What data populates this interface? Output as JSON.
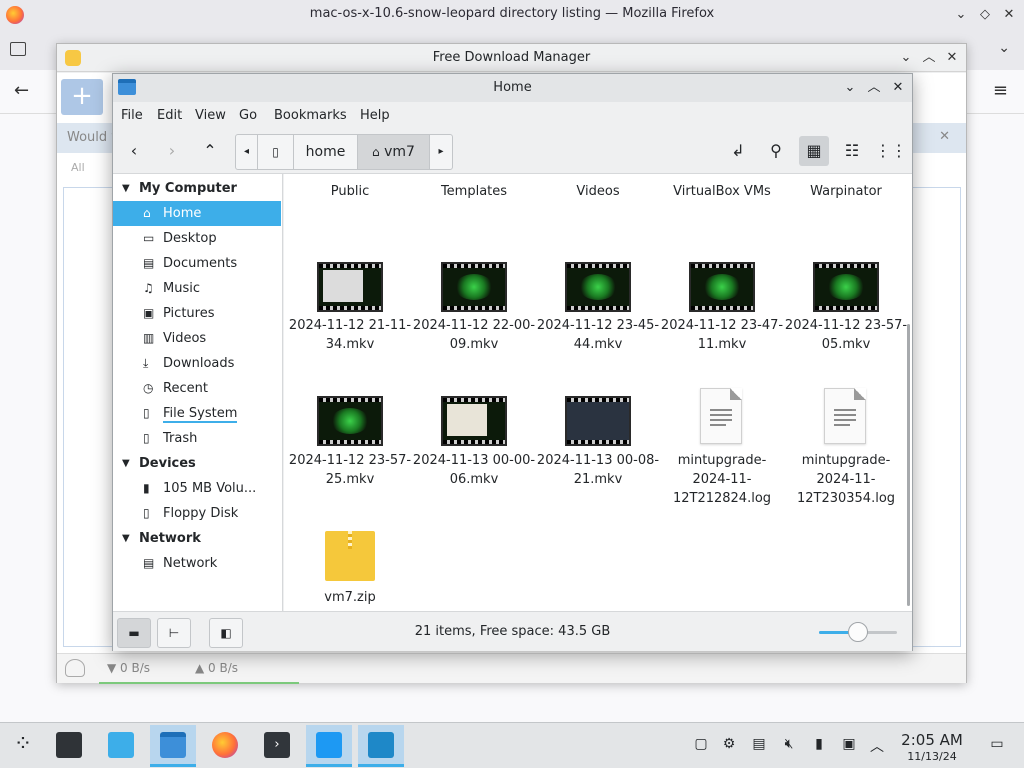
{
  "firefox": {
    "title": "mac-os-x-10.6-snow-leopard directory listing — Mozilla Firefox"
  },
  "fdm": {
    "title": "Free Download Manager",
    "banner_text": "Would y",
    "filter_label": "All",
    "download_speed": "▼ 0 B/s",
    "upload_speed": "▲ 0 B/s"
  },
  "nemo": {
    "title": "Home",
    "menu": [
      "File",
      "Edit",
      "View",
      "Go",
      "Bookmarks",
      "Help"
    ],
    "path": [
      "home",
      "vm7"
    ],
    "sidebar": {
      "my_computer": {
        "label": "My Computer",
        "items": [
          {
            "label": "Home",
            "icon": "home-icon"
          },
          {
            "label": "Desktop",
            "icon": "desktop-icon"
          },
          {
            "label": "Documents",
            "icon": "documents-icon"
          },
          {
            "label": "Music",
            "icon": "music-icon"
          },
          {
            "label": "Pictures",
            "icon": "pictures-icon"
          },
          {
            "label": "Videos",
            "icon": "videos-icon"
          },
          {
            "label": "Downloads",
            "icon": "downloads-icon"
          },
          {
            "label": "Recent",
            "icon": "recent-icon"
          },
          {
            "label": "File System",
            "icon": "filesystem-icon"
          },
          {
            "label": "Trash",
            "icon": "trash-icon"
          }
        ]
      },
      "devices": {
        "label": "Devices",
        "items": [
          {
            "label": "105 MB Volu...",
            "icon": "usb-drive-icon"
          },
          {
            "label": "Floppy Disk",
            "icon": "floppy-icon"
          }
        ]
      },
      "network": {
        "label": "Network",
        "items": [
          {
            "label": "Network",
            "icon": "network-icon"
          }
        ]
      }
    },
    "files_row0": [
      "Public",
      "Templates",
      "Videos",
      "VirtualBox VMs",
      "Warpinator"
    ],
    "files_row1": [
      "2024-11-12 21-11-34.mkv",
      "2024-11-12 22-00-09.mkv",
      "2024-11-12 23-45-44.mkv",
      "2024-11-12 23-47-11.mkv",
      "2024-11-12 23-57-05.mkv"
    ],
    "files_row2": [
      "2024-11-12 23-57-25.mkv",
      "2024-11-13 00-00-06.mkv",
      "2024-11-13 00-08-21.mkv",
      "mintupgrade-2024-11-12T212824.log",
      "mintupgrade-2024-11-12T230354.log"
    ],
    "files_row3": [
      "vm7.zip"
    ],
    "status": "21 items, Free space: 43.5 GB",
    "zoom_fraction": 0.5
  },
  "taskbar": {
    "time": "2:05 AM",
    "date": "11/13/24"
  },
  "colors": {
    "selection": "#3daee9",
    "taskbar_bg": "#e3e5e7"
  }
}
